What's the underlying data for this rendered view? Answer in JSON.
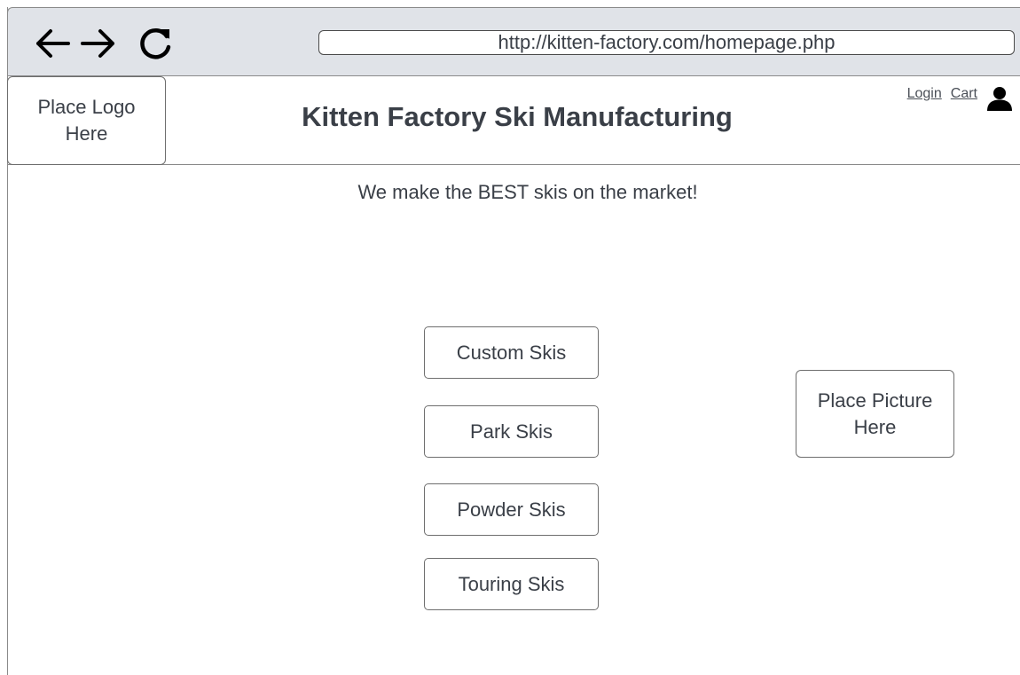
{
  "browser": {
    "url": "http://kitten-factory.com/homepage.php",
    "icons": [
      "back-arrow-icon",
      "forward-arrow-icon",
      "reload-icon"
    ]
  },
  "header": {
    "logo_placeholder": "Place Logo\nHere",
    "title": "Kitten Factory Ski Manufacturing",
    "login_label": "Login",
    "cart_label": "Cart",
    "user_icon": "user-icon"
  },
  "main": {
    "tagline": "We make the BEST skis on the market!",
    "ski_buttons": [
      {
        "label": "Custom Skis"
      },
      {
        "label": "Park Skis"
      },
      {
        "label": "Powder Skis"
      },
      {
        "label": "Touring Skis"
      }
    ],
    "picture_placeholder": "Place Picture\nHere"
  },
  "colors": {
    "chrome_background": "#e0e3e8",
    "border": "#6e6e6e",
    "text": "#3a3f47",
    "icon": "#000000"
  }
}
